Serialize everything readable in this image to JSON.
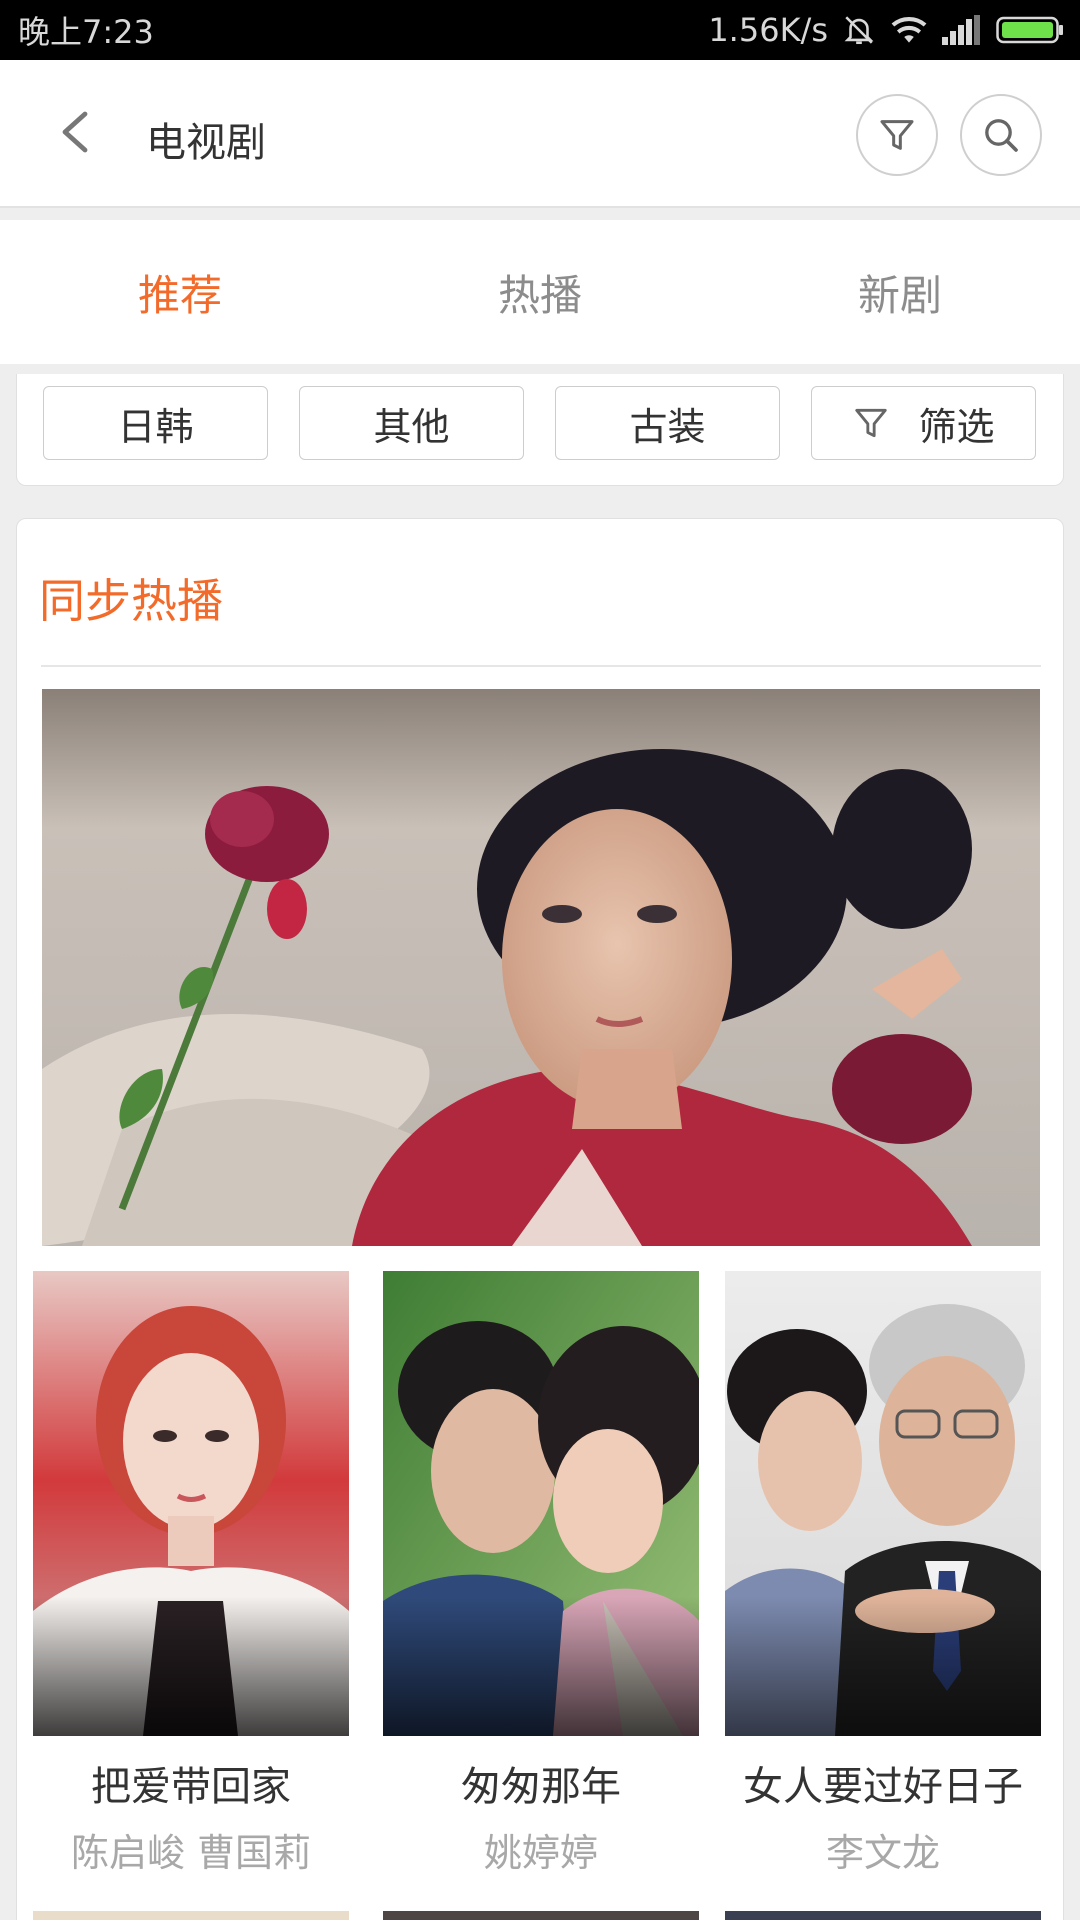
{
  "status_bar": {
    "time": "晚上7:23",
    "speed": "1.56K/s",
    "icons": [
      "bell-off-icon",
      "wifi-icon",
      "signal-icon",
      "battery-icon"
    ]
  },
  "header": {
    "title": "电视剧",
    "back_icon": "chevron-left-icon",
    "filter_icon": "filter-icon",
    "search_icon": "search-icon"
  },
  "tabs": [
    {
      "label": "推荐",
      "active": true
    },
    {
      "label": "热播",
      "active": false
    },
    {
      "label": "新剧",
      "active": false
    }
  ],
  "categories": [
    {
      "label": "日韩"
    },
    {
      "label": "其他"
    },
    {
      "label": "古装"
    },
    {
      "label": "筛选",
      "icon": "filter-icon"
    }
  ],
  "section": {
    "title": "同步热播"
  },
  "posters": [
    {
      "title": "把爱带回家",
      "cast": "陈启峻 曹国莉"
    },
    {
      "title": "匆匆那年",
      "cast": "姚婷婷"
    },
    {
      "title": "女人要过好日子",
      "cast": "李文龙"
    }
  ],
  "colors": {
    "accent": "#f36b2a",
    "tab_inactive": "#8c8c8c",
    "subtitle": "#a8a8a8"
  }
}
